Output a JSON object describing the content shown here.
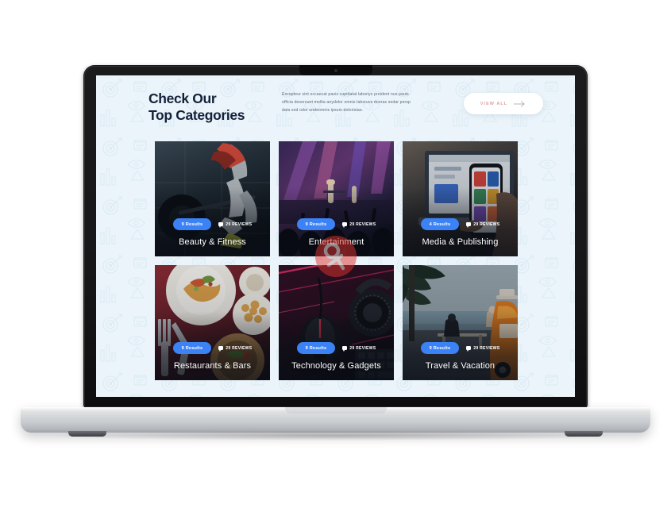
{
  "device": {
    "type": "laptop-mockup",
    "notch_icon": "camera-dot"
  },
  "header": {
    "title_line1": "Check Our",
    "title_line2": "Top Categories",
    "paragraph": "Excepteur sint occaecat pauis cupidatat laboriys proident nus pauis officia deserzunt molita anydolor omnis laboruvs doeras sedar persp data sed odor undeomnis ipsum doloristae.",
    "view_all_label": "VIEW ALL",
    "view_all_icon": "arrow-right-icon"
  },
  "colors": {
    "page_background": "#eaf4fa",
    "badge_blue": "#3b82f6",
    "heading": "#14213a",
    "paragraph": "#5d6a7c",
    "view_all_text": "#d9a0a8",
    "card_title": "#ffffff",
    "bezel": "#17171a",
    "base_silver": "#dcdee0"
  },
  "cards": [
    {
      "title": "Beauty & Fitness",
      "results_label": "9 Results",
      "reviews_label": "29 REVIEWS",
      "reviews_icon": "comment-icon",
      "photo": "gym-weightlifting"
    },
    {
      "title": "Entertainment",
      "results_label": "9 Results",
      "reviews_label": "29 REVIEWS",
      "reviews_icon": "comment-icon",
      "photo": "concert-stage-lights"
    },
    {
      "title": "Media & Publishing",
      "results_label": "4 Results",
      "reviews_label": "29 REVIEWS",
      "reviews_icon": "comment-icon",
      "photo": "phone-and-laptop"
    },
    {
      "title": "Restaurants & Bars",
      "results_label": "9 Results",
      "reviews_label": "29 REVIEWS",
      "reviews_icon": "comment-icon",
      "photo": "plated-food-table"
    },
    {
      "title": "Technology & Gadgets",
      "results_label": "9 Results",
      "reviews_label": "29 REVIEWS",
      "reviews_icon": "comment-icon",
      "photo": "gaming-mouse-headset"
    },
    {
      "title": "Travel & Vacation",
      "results_label": "9 Results",
      "reviews_label": "29 REVIEWS",
      "reviews_icon": "comment-icon",
      "photo": "beach-orange-van"
    }
  ],
  "watermark": {
    "icon": "red-circle-watermark"
  }
}
